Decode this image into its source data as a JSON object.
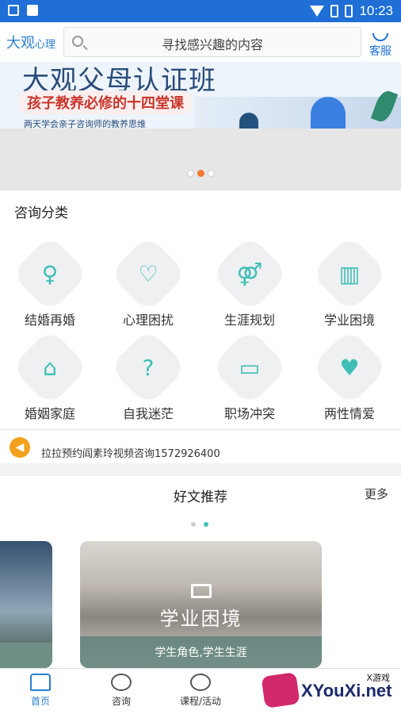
{
  "status_bar": {
    "time": "10:23"
  },
  "header": {
    "brand_main": "大观",
    "brand_sub": "心理",
    "search_placeholder": "寻找感兴趣的内容",
    "service_label": "客服"
  },
  "banner": {
    "title": "大观父母认证班",
    "subtitle": "孩子教养必修的十四堂课",
    "tagline": "两天学会亲子咨询师的教养思维",
    "carousel_index": 2,
    "carousel_count": 3
  },
  "categories": {
    "title": "咨询分类",
    "items": [
      {
        "label": "结婚再婚",
        "icon": "bride-icon"
      },
      {
        "label": "心理困扰",
        "icon": "heart-stethoscope-icon"
      },
      {
        "label": "生涯规划",
        "icon": "gender-icon"
      },
      {
        "label": "学业困境",
        "icon": "book-icon"
      },
      {
        "label": "婚姻家庭",
        "icon": "home-heart-icon"
      },
      {
        "label": "自我迷茫",
        "icon": "head-question-icon"
      },
      {
        "label": "职场冲突",
        "icon": "briefcase-icon"
      },
      {
        "label": "两性情爱",
        "icon": "couple-icon"
      }
    ]
  },
  "notice": {
    "text": "拉拉预约阎素玲视频咨询1572926400"
  },
  "articles": {
    "title": "好文推荐",
    "more_label": "更多",
    "page_index": 2,
    "page_count": 2,
    "featured": {
      "title": "学业困境",
      "caption": "学生角色,学生生涯"
    }
  },
  "tabbar": {
    "items": [
      {
        "label": "首页",
        "active": true
      },
      {
        "label": "咨询",
        "active": false
      },
      {
        "label": "课程/活动",
        "active": false
      }
    ]
  },
  "watermark": {
    "main": "XYouXi.net",
    "sub": "X游戏"
  },
  "colors": {
    "primary": "#1f6fd6",
    "accent": "#3fbfb6",
    "banner_dot": "#f07a2c",
    "notice_icon": "#f4a11f"
  }
}
